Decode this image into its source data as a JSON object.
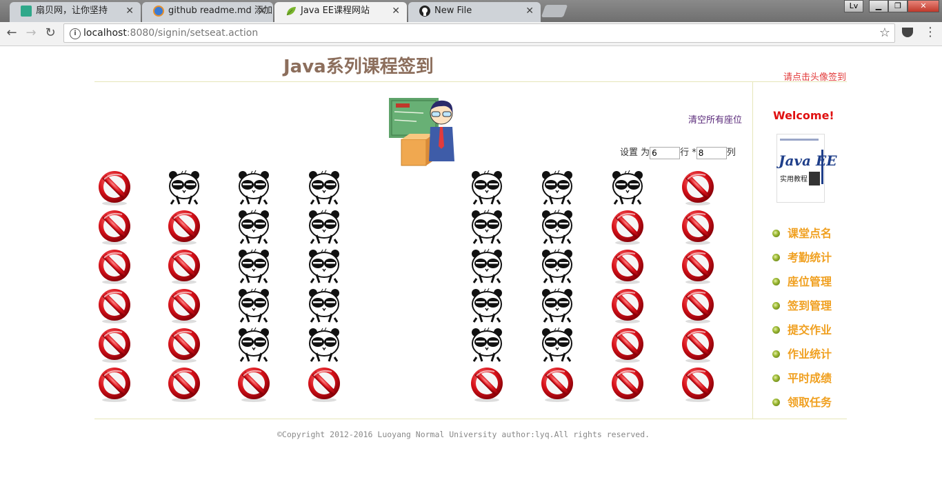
{
  "browser": {
    "tabs": [
      {
        "title": "扇贝网，让你坚持",
        "active": false
      },
      {
        "title": "github readme.md 添加",
        "active": false
      },
      {
        "title": "Java EE课程网站",
        "active": true
      },
      {
        "title": "New File",
        "active": false
      }
    ],
    "profile_label": "Lv",
    "url_host": "localhost",
    "url_path": ":8080/signin/setseat.action"
  },
  "page": {
    "title": "Java系列课程签到",
    "signin_hint": "请点击头像签到",
    "clear_seats": "清空所有座位",
    "set_label": "设置 为",
    "rows_value": "6",
    "rows_unit": "行 *",
    "cols_value": "8",
    "cols_unit": "列",
    "seats": [
      [
        "blocked",
        "panda",
        "panda",
        "panda",
        "panda",
        "panda",
        "panda",
        "blocked"
      ],
      [
        "blocked",
        "blocked",
        "panda",
        "panda",
        "panda",
        "panda",
        "blocked",
        "blocked"
      ],
      [
        "blocked",
        "blocked",
        "panda",
        "panda",
        "panda",
        "panda",
        "blocked",
        "blocked"
      ],
      [
        "blocked",
        "blocked",
        "panda",
        "panda",
        "panda",
        "panda",
        "blocked",
        "blocked"
      ],
      [
        "blocked",
        "blocked",
        "panda",
        "panda",
        "panda",
        "panda",
        "blocked",
        "blocked"
      ],
      [
        "blocked",
        "blocked",
        "blocked",
        "blocked",
        "blocked",
        "blocked",
        "blocked",
        "blocked"
      ]
    ]
  },
  "sidebar": {
    "welcome": "Welcome!",
    "book_title": "Java EE",
    "book_subtitle": "实用教程",
    "menu": [
      {
        "label": "课堂点名"
      },
      {
        "label": "考勤统计"
      },
      {
        "label": "座位管理"
      },
      {
        "label": "签到管理"
      },
      {
        "label": "提交作业"
      },
      {
        "label": "作业统计"
      },
      {
        "label": "平时成绩"
      },
      {
        "label": "领取任务"
      }
    ]
  },
  "footer": {
    "copyright": "©Copyright 2012-2016 Luoyang Normal University author:lyq.All rights reserved."
  }
}
